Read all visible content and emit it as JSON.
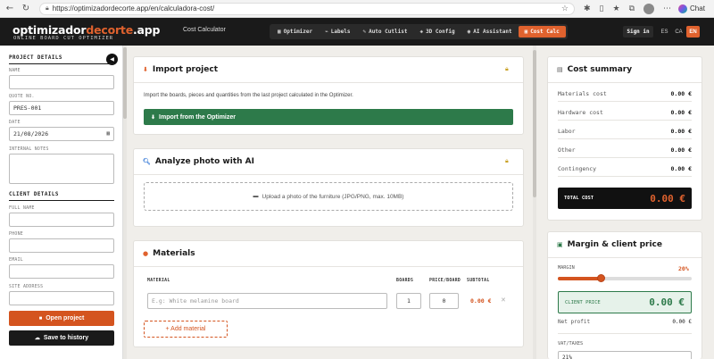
{
  "browser": {
    "url": "https://optimizadordecorte.app/en/calculadora-cost/",
    "chat_label": "Chat"
  },
  "header": {
    "logo_main": "optimizador",
    "logo_accent": "decorte",
    "logo_suffix": ".app",
    "logo_sub": "ONLINE BOARD CUT OPTIMIZER",
    "section_title": "Cost Calculator",
    "nav": [
      {
        "label": "Optimizer",
        "icon": "grid-icon",
        "glyph": "▦"
      },
      {
        "label": "Labels",
        "icon": "tag-icon",
        "glyph": "⌁"
      },
      {
        "label": "Auto Cutlist",
        "icon": "pencil-icon",
        "glyph": "✎"
      },
      {
        "label": "3D Config",
        "icon": "cube-icon",
        "glyph": "◈"
      },
      {
        "label": "AI Assistant",
        "icon": "robot-icon",
        "glyph": "◉"
      },
      {
        "label": "Cost Calc",
        "icon": "calculator-icon",
        "glyph": "▣"
      }
    ],
    "sign_in": "Sign in",
    "langs": [
      "ES",
      "CA",
      "EN"
    ],
    "accent": "#e0622e"
  },
  "sidebar": {
    "project_heading": "PROJECT DETAILS",
    "name_label": "NAME",
    "name_value": "",
    "quote_label": "QUOTE NO.",
    "quote_value": "PRES-001",
    "date_label": "DATE",
    "date_value": "21/08/2026",
    "notes_label": "INTERNAL NOTES",
    "client_heading": "CLIENT DETAILS",
    "fullname_label": "FULL NAME",
    "phone_label": "PHONE",
    "email_label": "EMAIL",
    "site_label": "SITE ADDRESS",
    "open_project": "Open project",
    "save_history": "Save to history"
  },
  "import_card": {
    "title": "Import project",
    "description": "Import the boards, pieces and quantities from the last project calculated in the Optimizer.",
    "button": "Import from the Optimizer"
  },
  "photo_card": {
    "title": "Analyze photo with AI",
    "upload_text": "Upload a photo of the furniture (JPG/PNG, max. 10MB)"
  },
  "materials_card": {
    "title": "Materials",
    "columns": [
      "MATERIAL",
      "BOARDS",
      "PRICE/BOARD",
      "SUBTOTAL"
    ],
    "row": {
      "placeholder": "E.g: White melamine board",
      "boards": "1",
      "price": "0",
      "subtotal": "0.00 €"
    },
    "add_button": "+ Add material"
  },
  "cost_summary": {
    "title": "Cost summary",
    "rows": [
      {
        "label": "Materials cost",
        "value": "0.00 €"
      },
      {
        "label": "Hardware cost",
        "value": "0.00 €"
      },
      {
        "label": "Labor",
        "value": "0.00 €"
      },
      {
        "label": "Other",
        "value": "0.00 €"
      },
      {
        "label": "Contingency",
        "value": "0.00 €"
      }
    ],
    "total_label": "TOTAL COST",
    "total_value": "0.00 €"
  },
  "margin_card": {
    "title": "Margin & client price",
    "margin_label": "MARGIN",
    "margin_value": "20%",
    "margin_fraction": 0.32,
    "client_price_label": "CLIENT PRICE",
    "client_price_value": "0.00 €",
    "net_profit_label": "Net profit",
    "net_profit_value": "0.00 €",
    "vat_label": "VAT/TAXES",
    "vat_value": "21%"
  }
}
